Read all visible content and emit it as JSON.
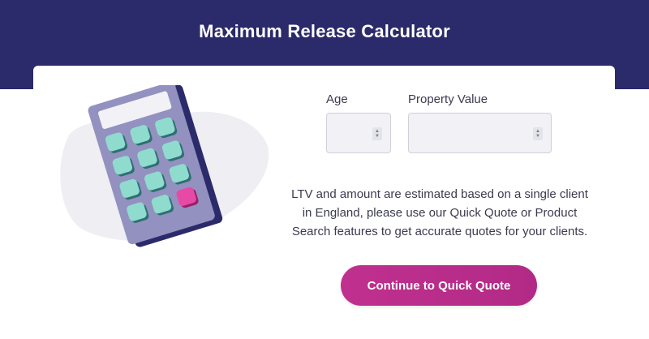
{
  "header": {
    "title": "Maximum Release Calculator"
  },
  "form": {
    "age": {
      "label": "Age",
      "value": ""
    },
    "property_value": {
      "label": "Property Value",
      "value": ""
    }
  },
  "disclaimer": "LTV and amount are estimated based on a single client in England, please use our Quick Quote or Product Search features to get accurate quotes for your clients.",
  "cta": {
    "label": "Continue to Quick Quote"
  },
  "illustration": {
    "icon": "calculator-icon"
  },
  "colors": {
    "header_bg": "#2b2a6a",
    "button": "#b82c89",
    "calculator_body": "#9391bf",
    "calculator_keys": "#8fdccf",
    "accent_key": "#e74aa6"
  }
}
